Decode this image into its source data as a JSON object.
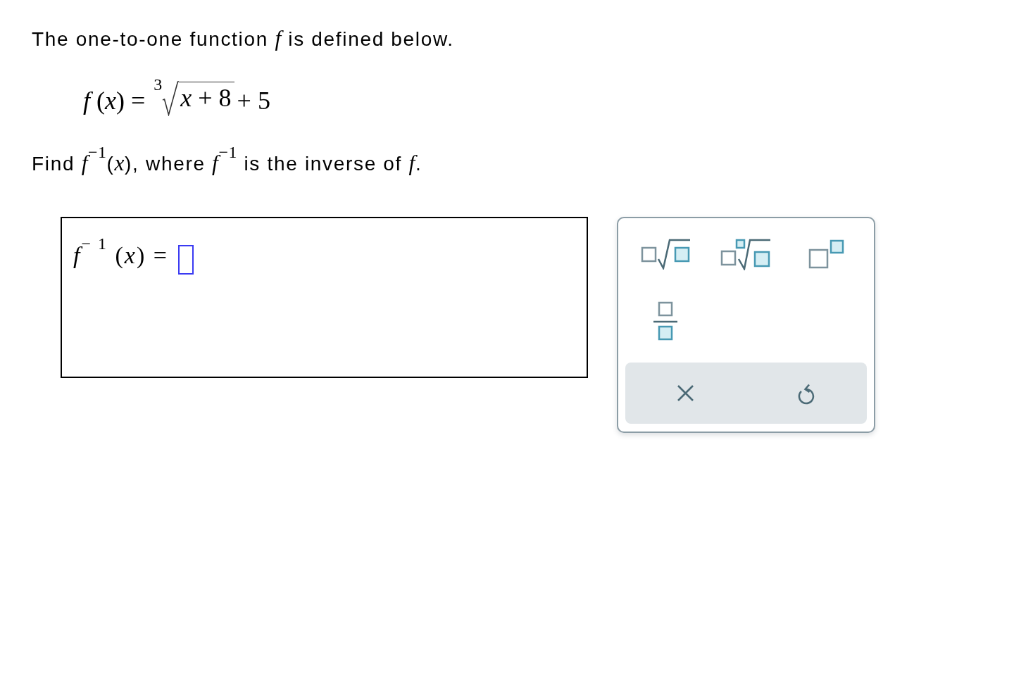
{
  "intro": "The one-to-one function *f* is defined below.",
  "definition": {
    "lhs": "*f* (*x*) =",
    "root_index": "3",
    "radicand": "*x* + 8",
    "tail": "+ 5"
  },
  "question": "Find *f*$^{−1}$(*x*), where *f*$^{−1}$ is the inverse of *f*.",
  "answer": {
    "prompt": "*f*$^{− 1}$ (*x*) ="
  },
  "palette": {
    "templates": [
      {
        "kind": "square_root"
      },
      {
        "kind": "nth_root"
      },
      {
        "kind": "power"
      },
      {
        "kind": "fraction"
      }
    ],
    "actions": [
      {
        "kind": "clear"
      },
      {
        "kind": "undo"
      }
    ]
  }
}
